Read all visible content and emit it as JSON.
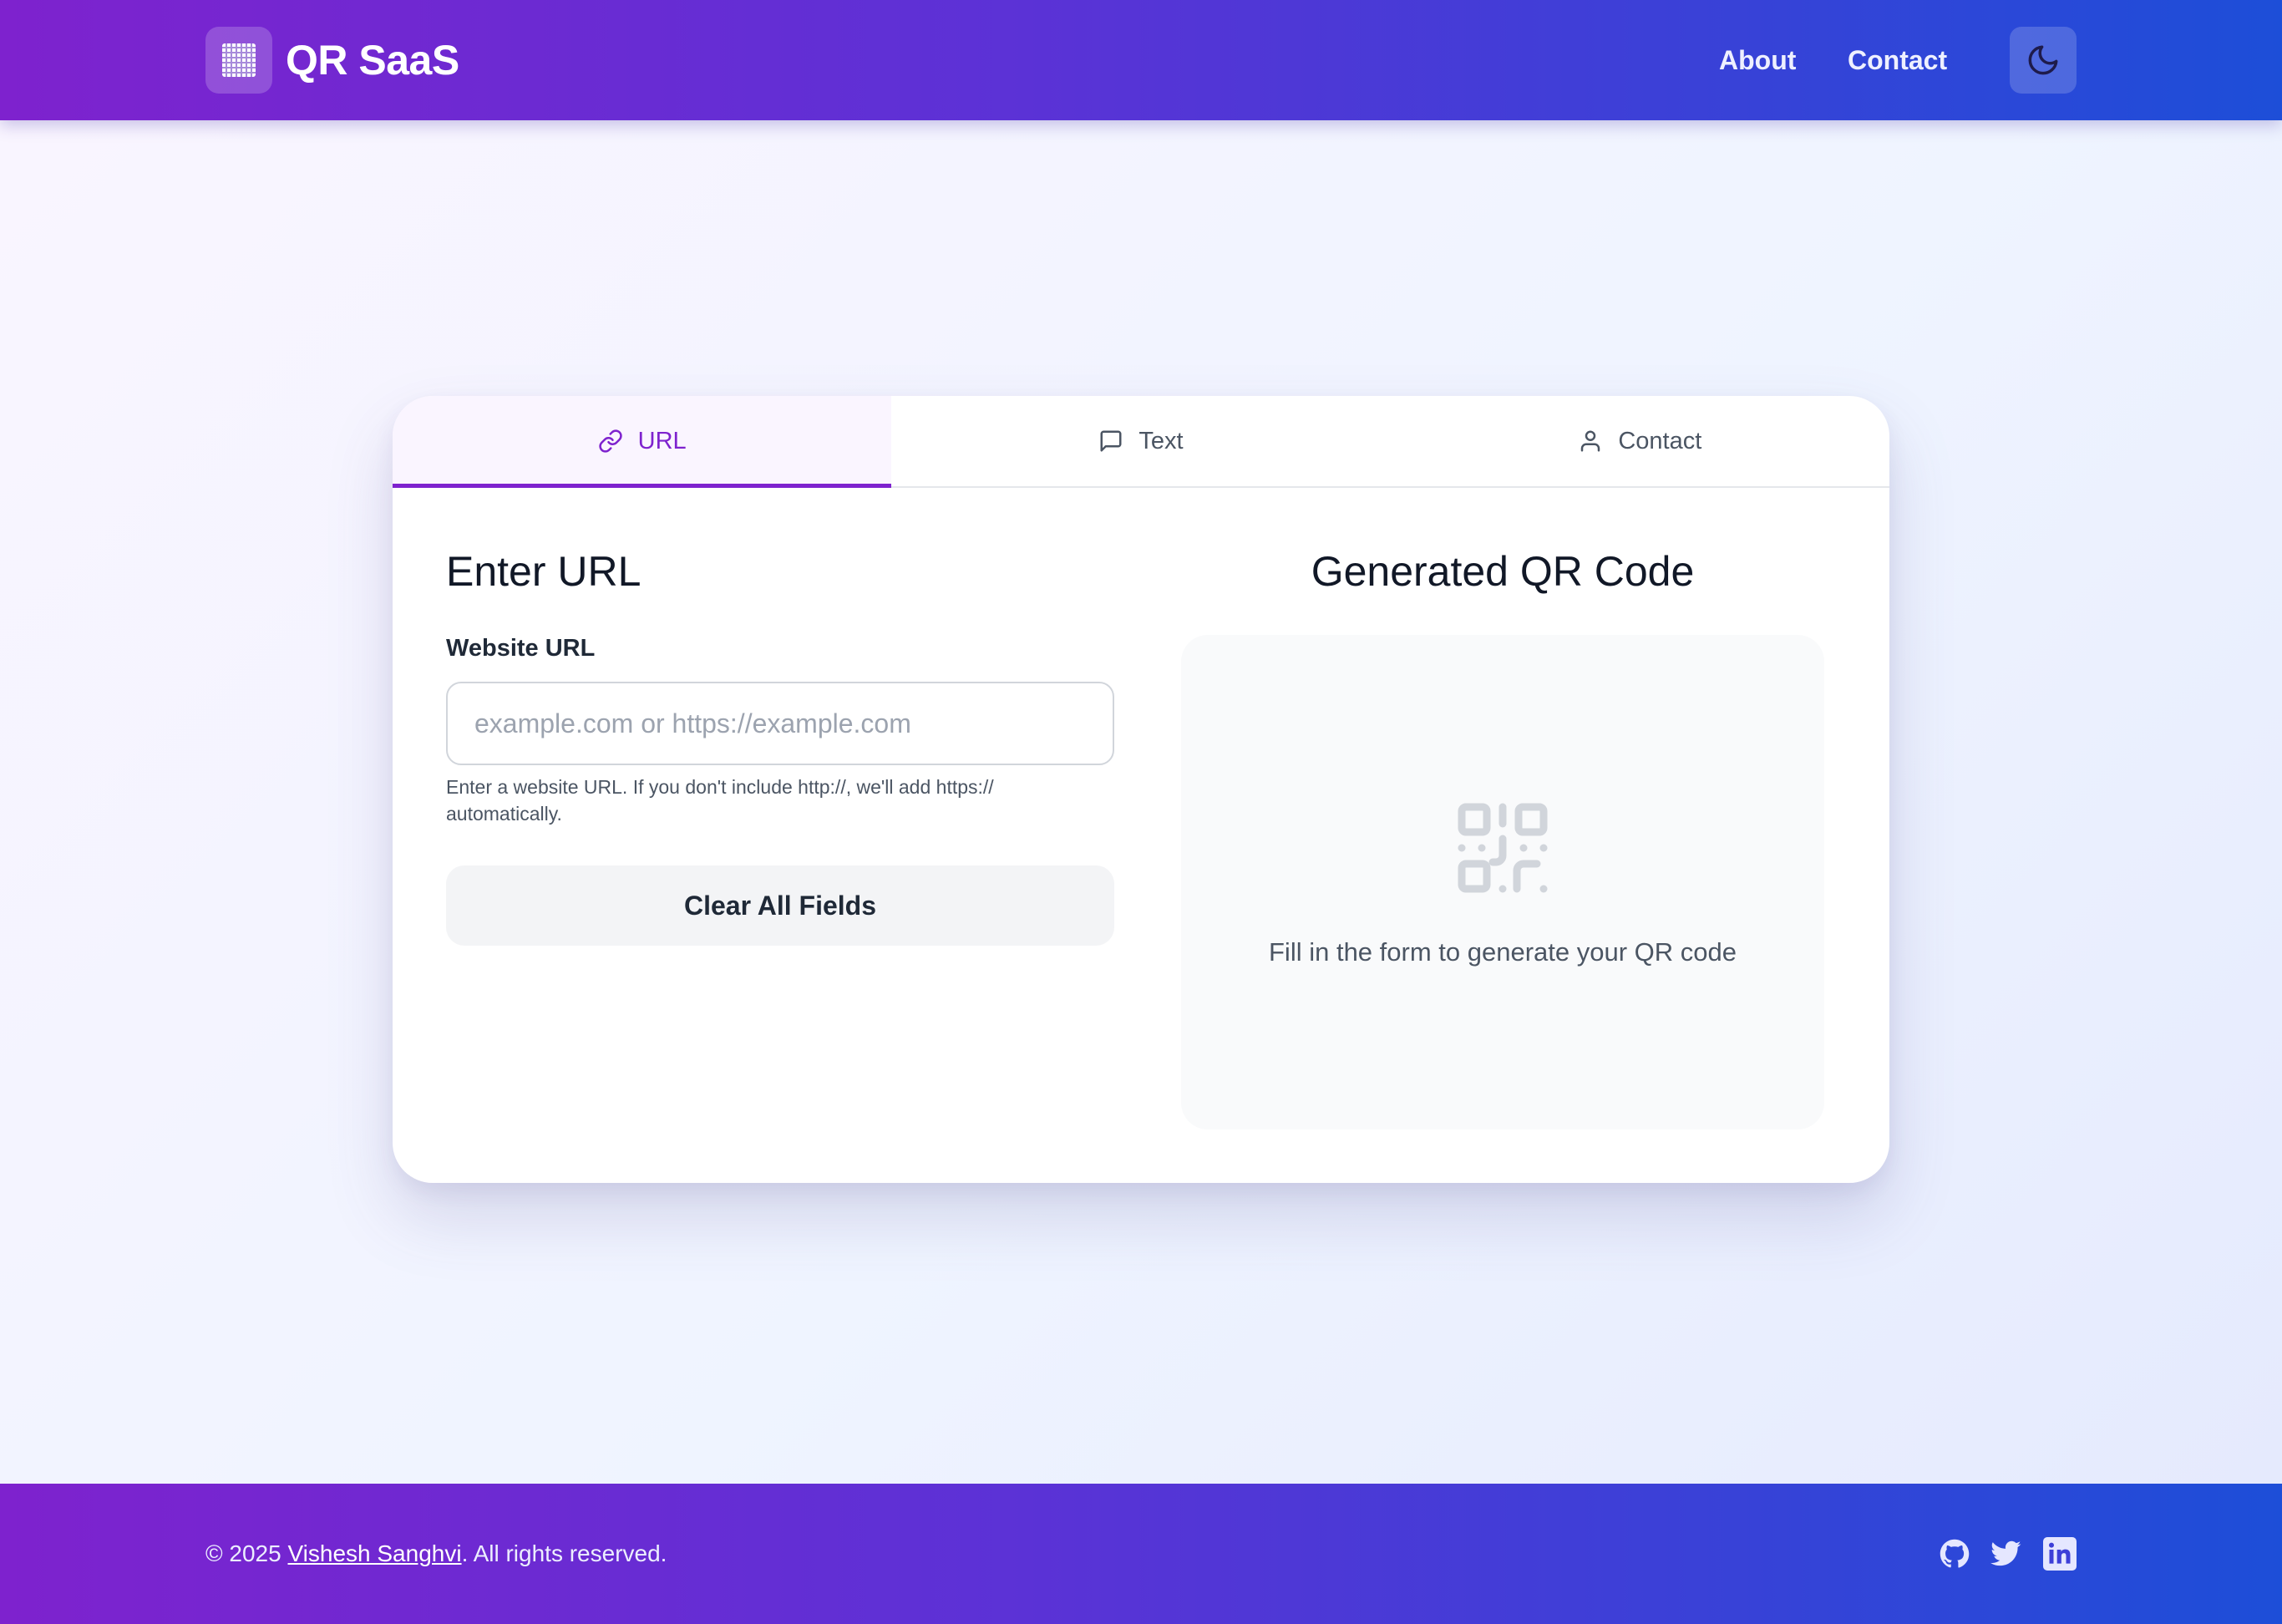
{
  "header": {
    "brand": "QR SaaS",
    "nav": {
      "about": "About",
      "contact": "Contact"
    }
  },
  "tabs": [
    {
      "label": "URL",
      "icon": "link-icon",
      "active": true
    },
    {
      "label": "Text",
      "icon": "message-icon",
      "active": false
    },
    {
      "label": "Contact",
      "icon": "user-icon",
      "active": false
    }
  ],
  "form": {
    "title": "Enter URL",
    "field_label": "Website URL",
    "input_value": "",
    "input_placeholder": "example.com or https://example.com",
    "hint": "Enter a website URL. If you don't include http://, we'll add https:// automatically.",
    "clear_label": "Clear All Fields"
  },
  "preview": {
    "title": "Generated QR Code",
    "empty_message": "Fill in the form to generate your QR code"
  },
  "footer": {
    "copy_prefix": "© 2025 ",
    "author": "Vishesh Sanghvi",
    "copy_suffix": ". All rights reserved.",
    "social": [
      "github-icon",
      "twitter-icon",
      "linkedin-icon"
    ]
  },
  "colors": {
    "brand_purple": "#7e22ce",
    "brand_blue": "#1d4ed8",
    "text_dark": "#111827",
    "muted": "#4b5563"
  }
}
